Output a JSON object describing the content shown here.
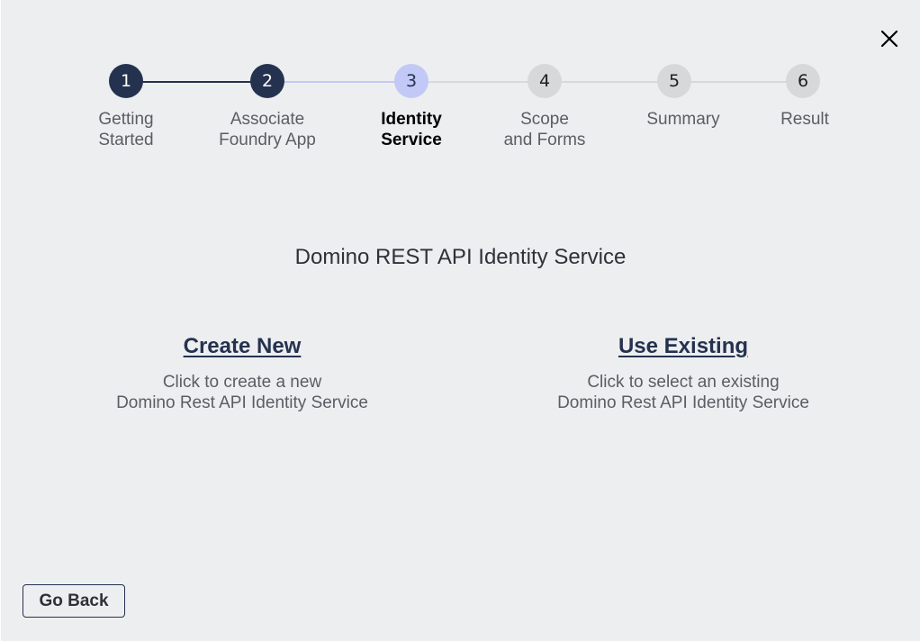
{
  "dialog": {
    "close_icon": "close-icon"
  },
  "stepper": {
    "steps": [
      {
        "number": "1",
        "line1": "Getting",
        "line2": "Started",
        "state": "done"
      },
      {
        "number": "2",
        "line1": "Associate",
        "line2": "Foundry App",
        "state": "done"
      },
      {
        "number": "3",
        "line1": "Identity",
        "line2": "Service",
        "state": "active"
      },
      {
        "number": "4",
        "line1": "Scope",
        "line2": "and Forms",
        "state": "pending"
      },
      {
        "number": "5",
        "line1": "Summary",
        "line2": "",
        "state": "pending"
      },
      {
        "number": "6",
        "line1": "Result",
        "line2": "",
        "state": "pending"
      }
    ],
    "colors": {
      "done": "#25324f",
      "active": "#c2c9f6",
      "pending": "#d7d8da"
    }
  },
  "main": {
    "title": "Domino REST API Identity Service",
    "create": {
      "label": "Create New",
      "desc_line1": "Click to create a new",
      "desc_line2": "Domino Rest API Identity Service"
    },
    "existing": {
      "label": "Use Existing",
      "desc_line1": "Click to select an existing",
      "desc_line2": "Domino Rest API Identity Service"
    }
  },
  "footer": {
    "go_back_label": "Go Back"
  }
}
